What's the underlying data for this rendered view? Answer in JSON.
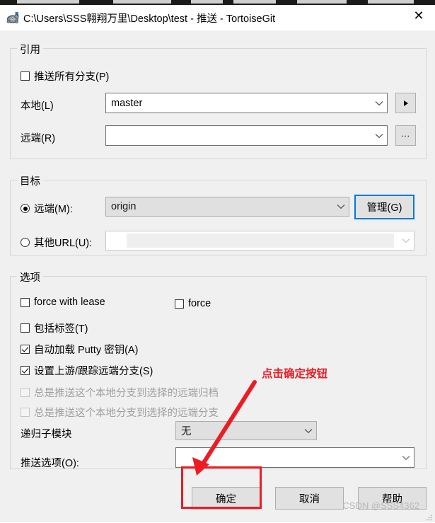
{
  "window": {
    "title": "C:\\Users\\SSS翱翔万里\\Desktop\\test - 推送 - TortoiseGit",
    "app_icon": "tortoisegit-turtle-icon",
    "close_label": "✕"
  },
  "groups": {
    "refs": {
      "title": "引用",
      "push_all_branches": {
        "label": "推送所有分支(P)",
        "checked": false
      },
      "local": {
        "label": "本地(L)",
        "value": "master",
        "button": "▶"
      },
      "remote": {
        "label": "远端(R)",
        "value": "",
        "button": "..."
      }
    },
    "destination": {
      "title": "目标",
      "remote_radio": {
        "label": "远端(M):",
        "selected": true,
        "value": "origin"
      },
      "manage_button": "管理(G)",
      "url_radio": {
        "label": "其他URL(U):",
        "selected": false,
        "value": ""
      }
    },
    "options": {
      "title": "选项",
      "checkboxes": [
        {
          "label": "force with lease",
          "checked": false,
          "disabled": false
        },
        {
          "label": "force",
          "checked": false,
          "disabled": false
        },
        {
          "label": "包括标签(T)",
          "checked": false,
          "disabled": false
        },
        {
          "label": "自动加载 Putty 密钥(A)",
          "checked": true,
          "disabled": false
        },
        {
          "label": "设置上游/跟踪远端分支(S)",
          "checked": true,
          "disabled": false
        },
        {
          "label": "总是推送这个本地分支到选择的远端归档",
          "checked": false,
          "disabled": true
        },
        {
          "label": "总是推送这个本地分支到选择的远端分支",
          "checked": false,
          "disabled": true
        }
      ],
      "recurse_submodules": {
        "label": "递归子模块",
        "value": "无"
      },
      "push_options": {
        "label": "推送选项(O):",
        "value": ""
      }
    }
  },
  "footer": {
    "ok_label": "确定",
    "cancel_label": "取消",
    "help_label": "帮助"
  },
  "annotation": {
    "text": "点击确定按钮",
    "color": "#ed1c24"
  },
  "watermark": "CSDN @SSS4362"
}
